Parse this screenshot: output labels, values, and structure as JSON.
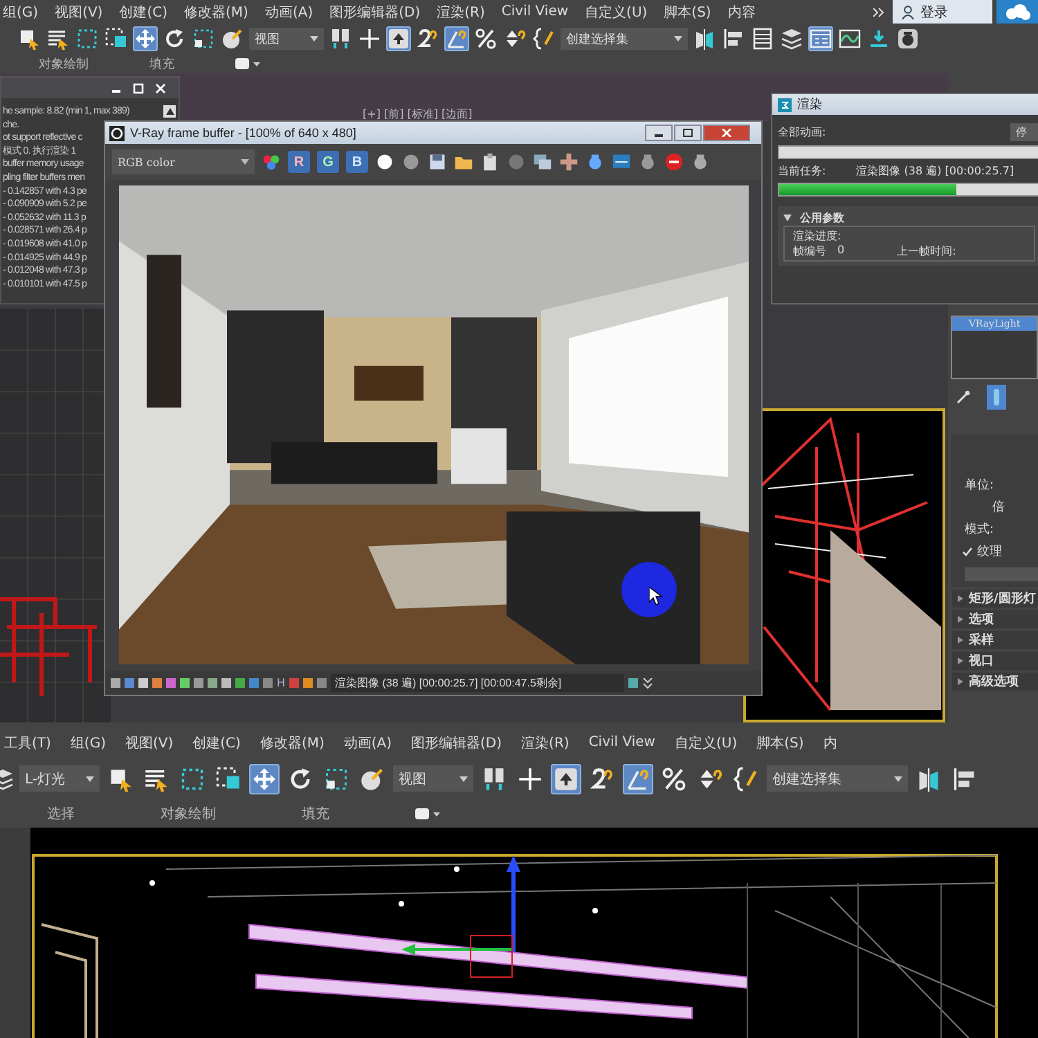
{
  "top_app": {
    "menu": [
      "组(G)",
      "视图(V)",
      "创建(C)",
      "修改器(M)",
      "动画(A)",
      "图形编辑器(D)",
      "渲染(R)",
      "Civil View",
      "自定义(U)",
      "脚本(S)",
      "内容"
    ],
    "login": "登录",
    "toolbar": [
      {
        "kind": "select",
        "selected": false
      },
      {
        "kind": "list",
        "selected": false
      },
      {
        "kind": "region",
        "selected": false
      },
      {
        "kind": "crossing",
        "selected": false
      },
      {
        "kind": "move",
        "selected": true
      },
      {
        "kind": "rotate",
        "selected": false
      },
      {
        "kind": "scale",
        "selected": false
      },
      {
        "kind": "place",
        "selected": false
      },
      {
        "kind": "dropdown",
        "value": "视图"
      },
      {
        "kind": "pivot",
        "selected": false
      },
      {
        "kind": "axis",
        "selected": false
      },
      {
        "kind": "push",
        "selected": true
      },
      {
        "kind": "snap",
        "selected": false
      },
      {
        "kind": "angle",
        "selected": true
      },
      {
        "kind": "percent",
        "selected": false
      },
      {
        "kind": "spinner",
        "selected": false
      },
      {
        "kind": "brace",
        "selected": false
      },
      {
        "kind": "dropdown",
        "value": "创建选择集"
      },
      {
        "kind": "mirror",
        "selected": false
      },
      {
        "kind": "align",
        "selected": false
      },
      {
        "kind": "table",
        "selected": false
      },
      {
        "kind": "layers",
        "selected": false
      },
      {
        "kind": "panel",
        "selected": true
      },
      {
        "kind": "curve",
        "selected": false
      },
      {
        "kind": "download",
        "selected": false
      },
      {
        "kind": "teapot",
        "selected": false
      }
    ],
    "ribbon_tabs": [
      "对象绘制",
      "填充"
    ],
    "viewport_label": "[+] [前] [标准] [边面]",
    "log_lines": [
      "he sample: 8.82 (min 1, max 389)",
      "che.",
      "ot support reflective c",
      "模式 0. 执行渲染 1",
      "buffer memory usage",
      "pling filter buffers men",
      "- 0.142857 with 4.3 pe",
      "- 0.090909 with 5.2 pe",
      "- 0.052632 with 11.3 p",
      "- 0.028571 with 26.4 p",
      "- 0.019608 with 41.0 p",
      "- 0.014925 with 44.9 p",
      "- 0.012048 with 47.3 p",
      "- 0.010101 with 47.5 p"
    ],
    "vray": {
      "title": "V-Ray frame buffer - [100% of 640 x 480]",
      "channel": "RGB color",
      "channels": [
        {
          "label": "R",
          "selected": true
        },
        {
          "label": "G",
          "selected": true
        },
        {
          "label": "B",
          "selected": true
        }
      ],
      "history_button": "H",
      "status": "渲染图像 (38 遍) [00:00:25.7] [00:00:47.5剩余]"
    },
    "render_dialog": {
      "title": "渲染",
      "all_label": "全部动画:",
      "stop_button": "停",
      "all_progress": {
        "level": 0
      },
      "task_label": "当前任务:",
      "task": "渲染图像 (38 遍) [00:00:25.7]",
      "task_progress": {
        "level": 0.68
      },
      "rollout": "公用参数",
      "group": "渲染进度:",
      "frame_label": "帧编号",
      "frame_value": "0",
      "last_frame_label": "上一帧时间:"
    },
    "command_panel": {
      "objects": [
        {
          "label": "VRayLight",
          "selected": true
        }
      ],
      "labels": [
        {
          "kind": "label",
          "text": "单位:"
        },
        {
          "kind": "label",
          "text": "倍"
        },
        {
          "kind": "label",
          "text": "模式:"
        },
        {
          "kind": "checkbox",
          "text": "纹理",
          "checked": true
        }
      ],
      "rollouts": [
        "矩形/圆形灯",
        "选项",
        "采样",
        "视口",
        "高级选项"
      ]
    }
  },
  "bottom_app": {
    "menu": [
      "工具(T)",
      "组(G)",
      "视图(V)",
      "创建(C)",
      "修改器(M)",
      "动画(A)",
      "图形编辑器(D)",
      "渲染(R)",
      "Civil View",
      "自定义(U)",
      "脚本(S)",
      "内"
    ],
    "toolbar": [
      {
        "kind": "dropdown",
        "value": "L-灯光"
      },
      {
        "kind": "select",
        "selected": false
      },
      {
        "kind": "list",
        "selected": false
      },
      {
        "kind": "region",
        "selected": false
      },
      {
        "kind": "crossing",
        "selected": false
      },
      {
        "kind": "move",
        "selected": true
      },
      {
        "kind": "rotate",
        "selected": false
      },
      {
        "kind": "scale",
        "selected": false
      },
      {
        "kind": "place",
        "selected": false
      },
      {
        "kind": "dropdown",
        "value": "视图"
      },
      {
        "kind": "pivot",
        "selected": false
      },
      {
        "kind": "axis",
        "selected": false
      },
      {
        "kind": "push",
        "selected": true
      },
      {
        "kind": "snap",
        "selected": false
      },
      {
        "kind": "angle",
        "selected": true
      },
      {
        "kind": "percent",
        "selected": false
      },
      {
        "kind": "spinner",
        "selected": false
      },
      {
        "kind": "brace",
        "selected": false
      },
      {
        "kind": "dropdown",
        "value": "创建选择集"
      },
      {
        "kind": "mirror",
        "selected": false
      },
      {
        "kind": "align",
        "selected": false
      }
    ],
    "ribbon_tabs": [
      "选择",
      "对象绘制",
      "填充"
    ]
  }
}
